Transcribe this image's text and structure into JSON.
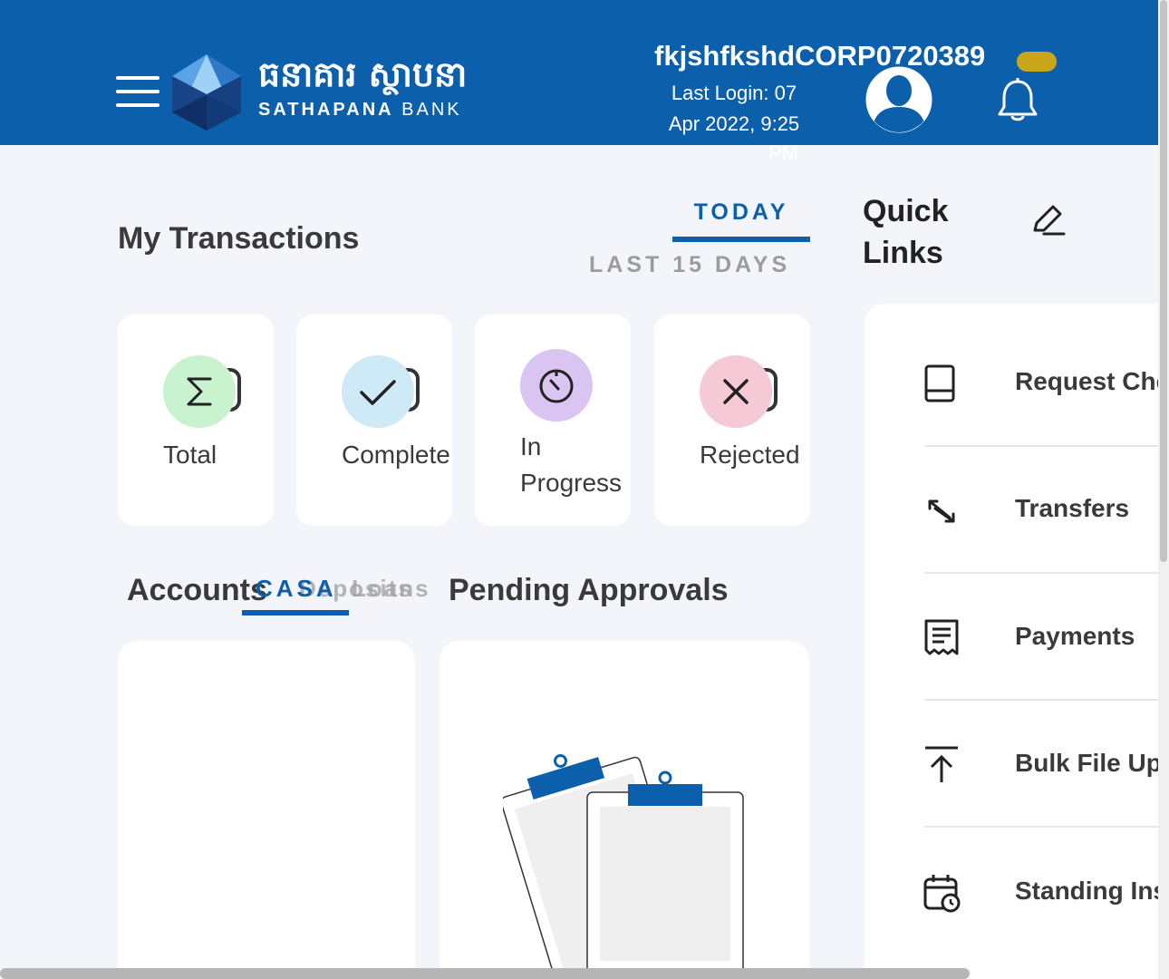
{
  "header": {
    "logo_khmer": "ធនាគារ ស្ថាបនា",
    "logo_en_left": "SATHAPANA",
    "logo_en_right": "BANK",
    "username": "fkjshfkshdCORP0720389",
    "last_login_line1": "Last Login: 07",
    "last_login_line2": "Apr 2022, 9:25",
    "last_login_line3": "PM"
  },
  "transactions": {
    "title": "My Transactions",
    "tab_today": "TODAY",
    "tab_last": "LAST 15 DAYS",
    "cards": [
      {
        "label": "Total",
        "icon": "sigma-icon",
        "color": "#c9f2cf"
      },
      {
        "label": "Complete",
        "icon": "check-icon",
        "color": "#cdeaf6"
      },
      {
        "label_line1": "In",
        "label_line2": "Progress",
        "icon": "timer-icon",
        "color": "#d9c4f2"
      },
      {
        "label": "Rejected",
        "icon": "close-icon",
        "color": "#f6c9d6"
      }
    ]
  },
  "accounts": {
    "title": "Accounts",
    "tab1": "CASA",
    "tab2": "Deposits",
    "tab3": "Loans"
  },
  "pending": {
    "title": "Pending Approvals"
  },
  "quick_links": {
    "title_line1": "Quick",
    "title_line2": "Links",
    "items": [
      {
        "label": "Request Che",
        "icon": "book-icon"
      },
      {
        "label": "Transfers",
        "icon": "transfer-arrows-icon"
      },
      {
        "label": "Payments",
        "icon": "receipt-icon"
      },
      {
        "label": "Bulk File Uplo",
        "icon": "upload-icon"
      },
      {
        "label": "Standing Inst",
        "icon": "calendar-clock-icon"
      }
    ]
  },
  "colors": {
    "brand": "#0b5fab",
    "accent": "#c9a51a"
  }
}
